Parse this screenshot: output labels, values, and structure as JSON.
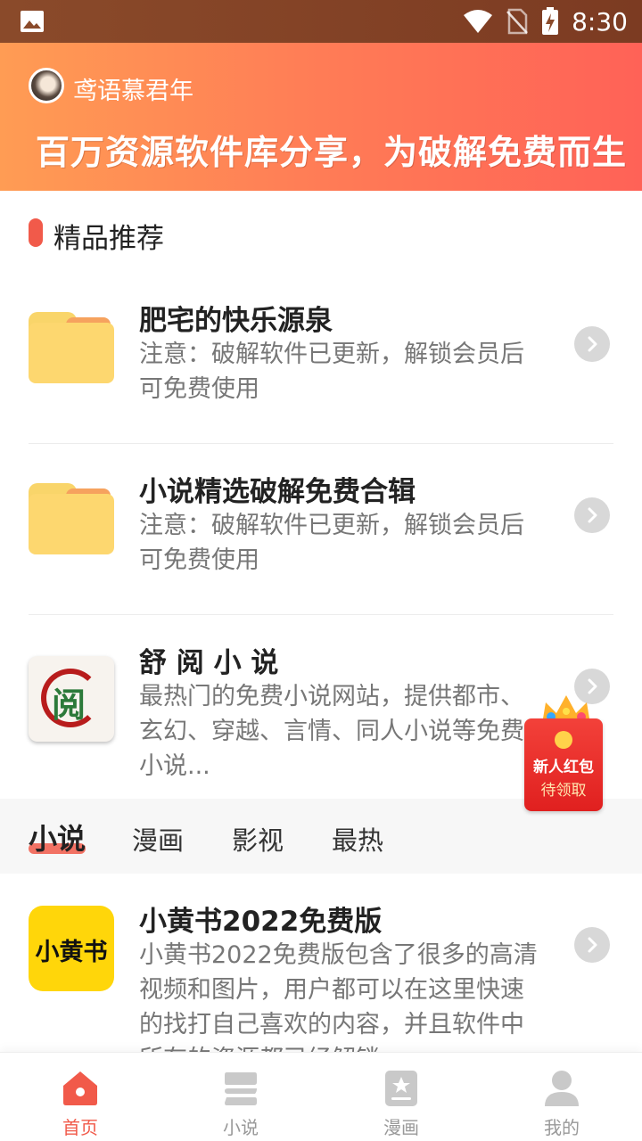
{
  "status_bar": {
    "time": "8:30"
  },
  "header": {
    "username": "鸢语慕君年",
    "slogan": "百万资源软件库分享，为破解免费而生"
  },
  "section": {
    "title": "精品推荐"
  },
  "featured": [
    {
      "title": "肥宅的快乐源泉",
      "desc": "注意：破解软件已更新，解锁会员后可免费使用",
      "icon": "folder-icon"
    },
    {
      "title": "小说精选破解免费合辑",
      "desc": "注意：破解软件已更新，解锁会员后可免费使用",
      "icon": "folder-icon"
    },
    {
      "title": "舒 阅 小 说",
      "desc": "最热门的免费小说网站，提供都市、玄幻、穿越、言情、同人小说等免费小说...",
      "icon": "shuyue-app-icon",
      "icon_char": "阅"
    }
  ],
  "tabs": [
    {
      "label": "小说",
      "active": true
    },
    {
      "label": "漫画",
      "active": false
    },
    {
      "label": "影视",
      "active": false
    },
    {
      "label": "最热",
      "active": false
    }
  ],
  "list": [
    {
      "title": "小黄书2022免费版",
      "desc": "小黄书2022免费版包含了很多的高清视频和图片，用户都可以在这里快速的找打自己喜欢的内容，并且软件中所有的资源都已经解锁",
      "icon_text": "小黄书"
    }
  ],
  "red_packet": {
    "line1": "新人红包",
    "line2": "待领取",
    "coin": "¥"
  },
  "bottom_nav": [
    {
      "label": "首页",
      "icon": "home-icon",
      "active": true
    },
    {
      "label": "小说",
      "icon": "novel-icon",
      "active": false
    },
    {
      "label": "漫画",
      "icon": "comic-icon",
      "active": false
    },
    {
      "label": "我的",
      "icon": "profile-icon",
      "active": false
    }
  ],
  "colors": {
    "accent": "#f15a4a",
    "banner_start": "#ff9c54",
    "banner_end": "#ff6257"
  }
}
